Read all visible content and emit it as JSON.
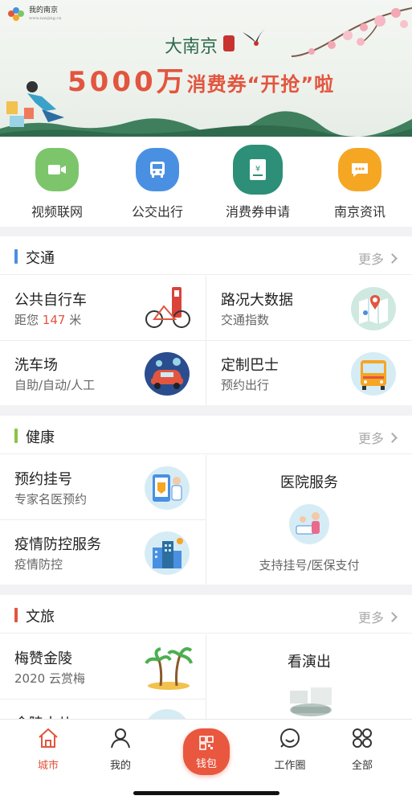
{
  "banner": {
    "logo_text": "我的南京",
    "logo_url_text": "www.nanjing.cn",
    "title_line1": "大南京",
    "title_line2_big": "5000万",
    "title_line2_small": "消费券“开抢”啦"
  },
  "quick_links": [
    {
      "label": "视频联网",
      "icon": "video-icon",
      "color": "#7cc56b"
    },
    {
      "label": "公交出行",
      "icon": "bus-icon",
      "color": "#4a90e2"
    },
    {
      "label": "消费券申请",
      "icon": "voucher-icon",
      "color": "#2d8f77"
    },
    {
      "label": "南京资讯",
      "icon": "chat-bubble-icon",
      "color": "#f5a623"
    }
  ],
  "sections": {
    "traffic": {
      "title": "交通",
      "more": "更多",
      "accent": "#4a90e2",
      "items": [
        {
          "title": "公共自行车",
          "sub_prefix": "距您",
          "sub_value": "147",
          "sub_suffix": "米"
        },
        {
          "title": "路况大数据",
          "sub": "交通指数"
        },
        {
          "title": "洗车场",
          "sub": "自助/自动/人工"
        },
        {
          "title": "定制巴士",
          "sub": "预约出行"
        }
      ]
    },
    "health": {
      "title": "健康",
      "more": "更多",
      "accent": "#8bc34a",
      "items": [
        {
          "title": "预约挂号",
          "sub": "专家名医预约"
        },
        {
          "title": "疫情防控服务",
          "sub": "疫情防控"
        },
        {
          "title": "医院服务",
          "sub": "支持挂号/医保支付"
        }
      ]
    },
    "culture": {
      "title": "文旅",
      "more": "更多",
      "accent": "#e2553f",
      "items": [
        {
          "title": "梅赞金陵",
          "sub": "2020 云赏梅"
        },
        {
          "title": "金陵小儿",
          "sub": ""
        },
        {
          "title": "看演出",
          "sub": ""
        }
      ]
    }
  },
  "tabbar": {
    "items": [
      {
        "label": "城市",
        "icon": "home-icon"
      },
      {
        "label": "我的",
        "icon": "user-icon"
      },
      {
        "label": "钱包",
        "icon": "qr-code-icon"
      },
      {
        "label": "工作圈",
        "icon": "circle-chat-icon"
      },
      {
        "label": "全部",
        "icon": "grid-icon"
      }
    ],
    "active_color": "#e2553f"
  }
}
